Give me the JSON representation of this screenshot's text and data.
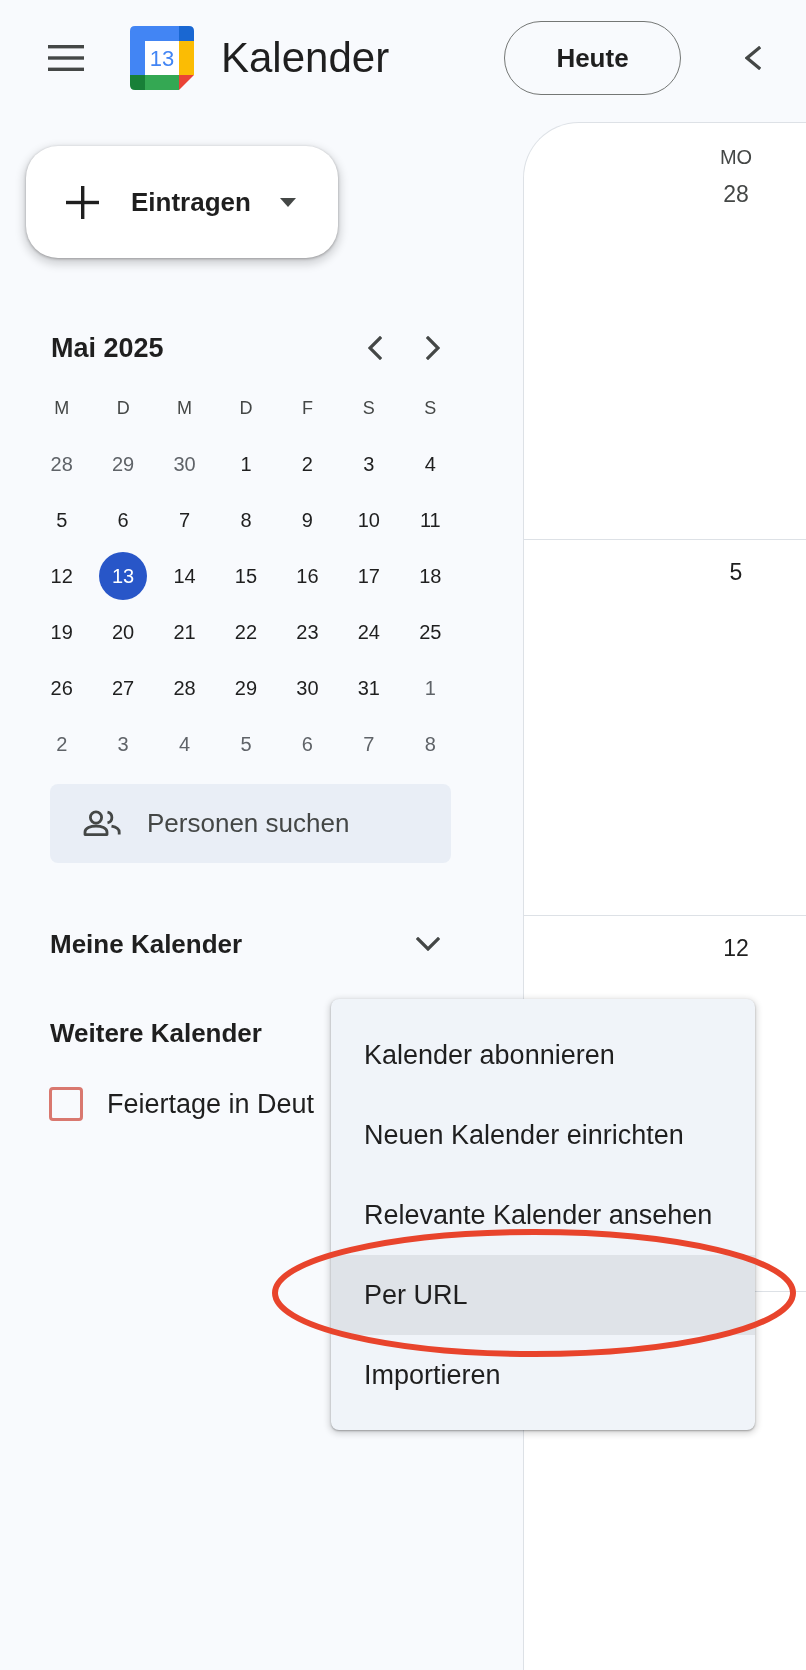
{
  "header": {
    "logo_day": "13",
    "title": "Kalender",
    "today_button": "Heute"
  },
  "create_button": {
    "label": "Eintragen"
  },
  "mini_calendar": {
    "title": "Mai 2025",
    "weekdays": [
      "M",
      "D",
      "M",
      "D",
      "F",
      "S",
      "S"
    ],
    "weeks": [
      [
        {
          "day": "28",
          "in_month": false,
          "selected": false
        },
        {
          "day": "29",
          "in_month": false,
          "selected": false
        },
        {
          "day": "30",
          "in_month": false,
          "selected": false
        },
        {
          "day": "1",
          "in_month": true,
          "selected": false
        },
        {
          "day": "2",
          "in_month": true,
          "selected": false
        },
        {
          "day": "3",
          "in_month": true,
          "selected": false
        },
        {
          "day": "4",
          "in_month": true,
          "selected": false
        }
      ],
      [
        {
          "day": "5",
          "in_month": true,
          "selected": false
        },
        {
          "day": "6",
          "in_month": true,
          "selected": false
        },
        {
          "day": "7",
          "in_month": true,
          "selected": false
        },
        {
          "day": "8",
          "in_month": true,
          "selected": false
        },
        {
          "day": "9",
          "in_month": true,
          "selected": false
        },
        {
          "day": "10",
          "in_month": true,
          "selected": false
        },
        {
          "day": "11",
          "in_month": true,
          "selected": false
        }
      ],
      [
        {
          "day": "12",
          "in_month": true,
          "selected": false
        },
        {
          "day": "13",
          "in_month": true,
          "selected": true
        },
        {
          "day": "14",
          "in_month": true,
          "selected": false
        },
        {
          "day": "15",
          "in_month": true,
          "selected": false
        },
        {
          "day": "16",
          "in_month": true,
          "selected": false
        },
        {
          "day": "17",
          "in_month": true,
          "selected": false
        },
        {
          "day": "18",
          "in_month": true,
          "selected": false
        }
      ],
      [
        {
          "day": "19",
          "in_month": true,
          "selected": false
        },
        {
          "day": "20",
          "in_month": true,
          "selected": false
        },
        {
          "day": "21",
          "in_month": true,
          "selected": false
        },
        {
          "day": "22",
          "in_month": true,
          "selected": false
        },
        {
          "day": "23",
          "in_month": true,
          "selected": false
        },
        {
          "day": "24",
          "in_month": true,
          "selected": false
        },
        {
          "day": "25",
          "in_month": true,
          "selected": false
        }
      ],
      [
        {
          "day": "26",
          "in_month": true,
          "selected": false
        },
        {
          "day": "27",
          "in_month": true,
          "selected": false
        },
        {
          "day": "28",
          "in_month": true,
          "selected": false
        },
        {
          "day": "29",
          "in_month": true,
          "selected": false
        },
        {
          "day": "30",
          "in_month": true,
          "selected": false
        },
        {
          "day": "31",
          "in_month": true,
          "selected": false
        },
        {
          "day": "1",
          "in_month": false,
          "selected": false
        }
      ],
      [
        {
          "day": "2",
          "in_month": false,
          "selected": false
        },
        {
          "day": "3",
          "in_month": false,
          "selected": false
        },
        {
          "day": "4",
          "in_month": false,
          "selected": false
        },
        {
          "day": "5",
          "in_month": false,
          "selected": false
        },
        {
          "day": "6",
          "in_month": false,
          "selected": false
        },
        {
          "day": "7",
          "in_month": false,
          "selected": false
        },
        {
          "day": "8",
          "in_month": false,
          "selected": false
        }
      ]
    ]
  },
  "people_search": {
    "placeholder": "Personen suchen"
  },
  "calendar_sections": [
    {
      "title": "Meine Kalender",
      "expanded": false
    },
    {
      "title": "Weitere Kalender",
      "calendars": [
        {
          "name": "Feiertage in Deut",
          "checked": false,
          "color": "#d9786f"
        }
      ]
    }
  ],
  "month_view": {
    "weekday": "MO",
    "weeks": [
      {
        "date": "28",
        "in_month": false
      },
      {
        "date": "5",
        "in_month": true
      },
      {
        "date": "12",
        "in_month": true
      }
    ]
  },
  "context_menu": {
    "items": [
      {
        "label": "Kalender abonnieren",
        "highlighted": false,
        "circled": false
      },
      {
        "label": "Neuen Kalender einrichten",
        "highlighted": false,
        "circled": false
      },
      {
        "label": "Relevante Kalender ansehen",
        "highlighted": false,
        "circled": false
      },
      {
        "label": "Per URL",
        "highlighted": true,
        "circled": true
      },
      {
        "label": "Importieren",
        "highlighted": false,
        "circled": false
      }
    ]
  }
}
